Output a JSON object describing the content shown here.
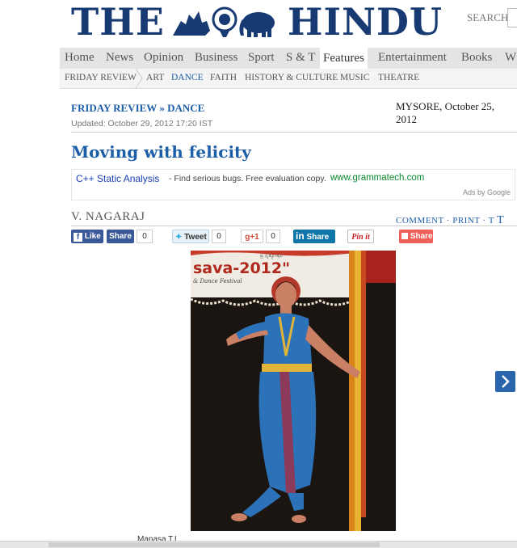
{
  "masthead": {
    "left": "THE",
    "right": "HINDU"
  },
  "search": {
    "label": "SEARCH"
  },
  "nav_primary": [
    "Home",
    "News",
    "Opinion",
    "Business",
    "Sport",
    "S & T",
    "Features",
    "Entertainment",
    "Books",
    "W"
  ],
  "nav_primary_active": "Features",
  "nav_secondary": [
    "FRIDAY REVIEW",
    "ART",
    "DANCE",
    "FAITH",
    "HISTORY & CULTURE",
    "MUSIC",
    "THEATRE"
  ],
  "nav_secondary_active": "DANCE",
  "breadcrumb": {
    "section": "FRIDAY REVIEW",
    "separator": "»",
    "subsection": "DANCE"
  },
  "dateline": "MYSORE, October 25, 2012",
  "updated": "Updated: October 29, 2012 17:20 IST",
  "headline": "Moving with felicity",
  "ad": {
    "title": "C++ Static Analysis",
    "text": "- Find serious bugs. Free evaluation copy.",
    "url": "www.grammatech.com",
    "by": "Ads by Google"
  },
  "byline": "V. NAGARAJ",
  "article_tools": {
    "comment": "COMMENT",
    "sep": "·",
    "print": "PRINT",
    "font_small": "T",
    "font_large": "T"
  },
  "share": {
    "fb_like": "Like",
    "fb_share": "Share",
    "fb_count": "0",
    "tweet": "Tweet",
    "tweet_count": "0",
    "gplus": "+1",
    "gplus_count": "0",
    "linkedin": "Share",
    "pinit": "Pin it",
    "share": "Share"
  },
  "photo": {
    "banner_text": "sava-2012\"",
    "banner_sub": "& Dance Festival",
    "banner_script": "ಪ್ರ ನೃತ್ಯೋತ್ಸವ"
  },
  "caption": "Manasa T.L.",
  "colors": {
    "brand_blue": "#173a73",
    "link_blue": "#1c5ea8",
    "nav_bg": "#e4e4e4"
  }
}
